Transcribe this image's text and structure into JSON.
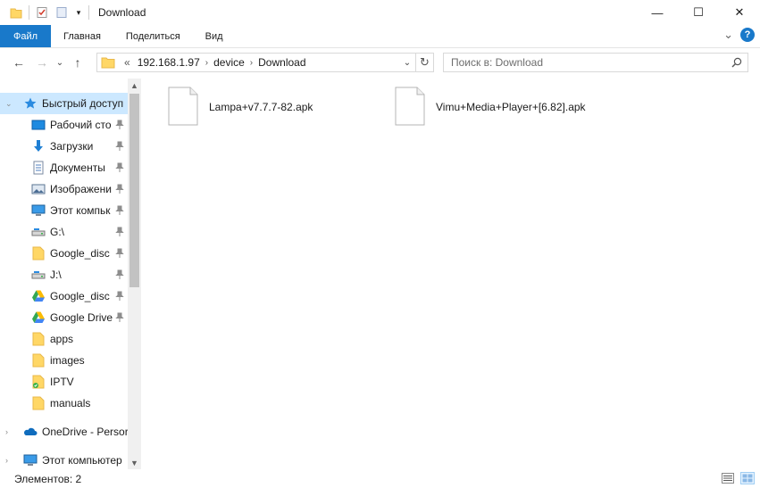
{
  "window": {
    "title": "Download",
    "controls": {
      "minimize": "—",
      "maximize": "☐",
      "close": "✕"
    }
  },
  "ribbon": {
    "tabs": [
      "Файл",
      "Главная",
      "Поделиться",
      "Вид"
    ],
    "collapse_glyph": "⌄",
    "help_glyph": "?"
  },
  "address": {
    "back_glyph": "←",
    "forward_glyph": "→",
    "recent_glyph": "⌄",
    "up_glyph": "↑",
    "overflow": "«",
    "crumbs": [
      "192.168.1.97",
      "device",
      "Download"
    ],
    "crumb_sep": "›",
    "dropdown_glyph": "⌄",
    "refresh_glyph": "↻"
  },
  "search": {
    "placeholder": "Поиск в: Download"
  },
  "nav": {
    "quick_access": {
      "label": "Быстрый доступ",
      "icon": "star-icon"
    },
    "items": [
      {
        "label": "Рабочий сто",
        "icon": "desktop-icon",
        "pinned": true
      },
      {
        "label": "Загрузки",
        "icon": "download-arrow-icon",
        "pinned": true
      },
      {
        "label": "Документы",
        "icon": "document-icon",
        "pinned": true
      },
      {
        "label": "Изображени",
        "icon": "pictures-icon",
        "pinned": true
      },
      {
        "label": "Этот компьк",
        "icon": "computer-icon",
        "pinned": true
      },
      {
        "label": "G:\\",
        "icon": "network-drive-icon",
        "pinned": true
      },
      {
        "label": "Google_disc",
        "icon": "folder-icon",
        "pinned": true
      },
      {
        "label": "J:\\",
        "icon": "network-drive-icon",
        "pinned": true
      },
      {
        "label": "Google_disc",
        "icon": "google-drive-icon",
        "pinned": true
      },
      {
        "label": "Google Drive",
        "icon": "google-drive-icon",
        "pinned": true
      },
      {
        "label": "apps",
        "icon": "folder-icon",
        "pinned": false
      },
      {
        "label": "images",
        "icon": "folder-icon",
        "pinned": false
      },
      {
        "label": "IPTV",
        "icon": "folder-sync-icon",
        "pinned": false
      },
      {
        "label": "manuals",
        "icon": "folder-icon",
        "pinned": false
      }
    ],
    "onedrive": {
      "label": "OneDrive - Persor",
      "icon": "onedrive-icon"
    },
    "this_pc": {
      "label": "Этот компьютер",
      "icon": "computer-icon"
    },
    "scroll_up": "▲",
    "scroll_down": "▼",
    "expander": "›",
    "expander_open": "⌄"
  },
  "files": [
    {
      "name": "Lampa+v7.7.7-82.apk",
      "icon": "file-icon"
    },
    {
      "name": "Vimu+Media+Player+[6.82].apk",
      "icon": "file-icon"
    }
  ],
  "status": {
    "count_text": "Элементов: 2"
  },
  "colors": {
    "accent": "#1979ca",
    "selection": "#cce8ff",
    "folder": "#ffd766",
    "folder_dark": "#e8b84a"
  }
}
